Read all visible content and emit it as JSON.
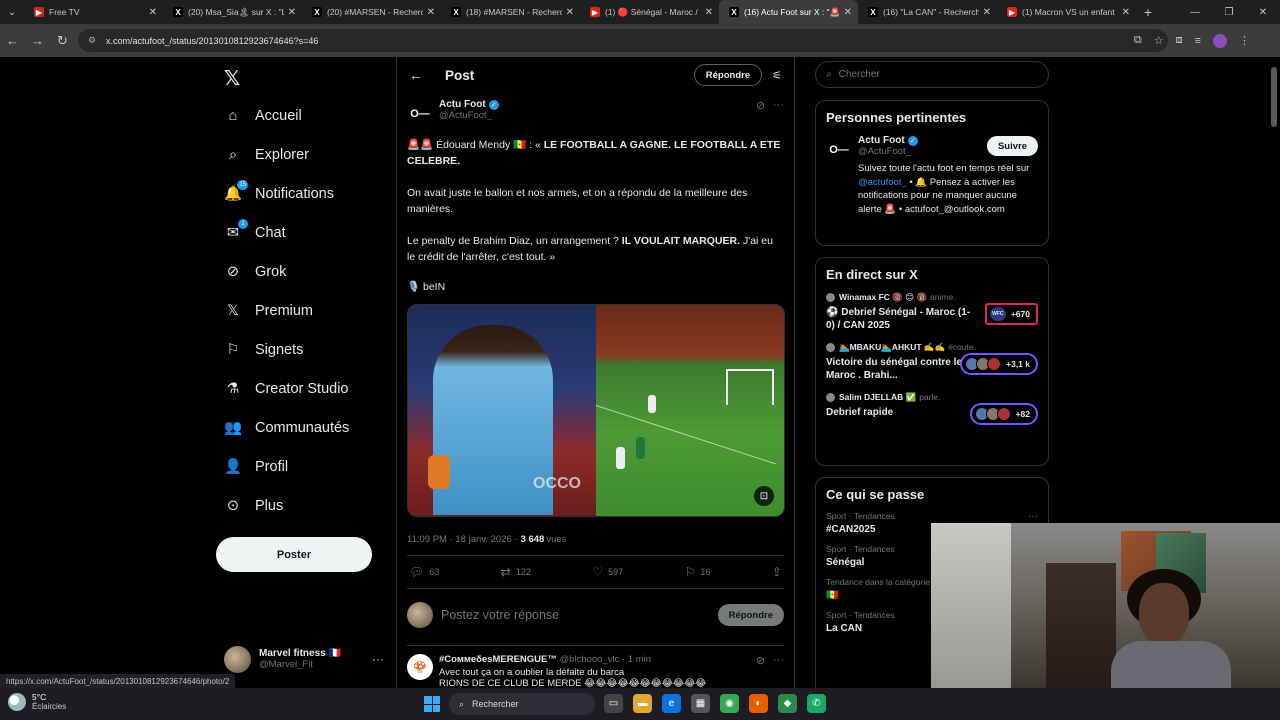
{
  "browser": {
    "tabs": [
      {
        "title": "Free TV",
        "fav_color": "#c62828",
        "fav": "▶",
        "active": false
      },
      {
        "title": "(20) Msa_Sia🏝 sur X : \"L'",
        "fav_color": "#000000",
        "fav": "X",
        "active": false
      },
      {
        "title": "(20) #MARSEN - Recherche",
        "fav_color": "#000000",
        "fav": "X",
        "active": false
      },
      {
        "title": "(18) #MARSEN - Recherche",
        "fav_color": "#000000",
        "fav": "X",
        "active": false
      },
      {
        "title": "(1) 🔴 Sénégal - Maroc /",
        "fav_color": "#e62117",
        "fav": "▶",
        "active": false
      },
      {
        "title": "(16) Actu Foot sur X : \"🚨",
        "fav_color": "#000000",
        "fav": "X",
        "active": true
      },
      {
        "title": "(16) \"La CAN\" - Recherche",
        "fav_color": "#000000",
        "fav": "X",
        "active": false
      },
      {
        "title": "(1) Macron VS un enfant",
        "fav_color": "#e62117",
        "fav": "▶",
        "active": false
      }
    ],
    "url": "x.com/actufoot_/status/2013010812923674646?s=46",
    "status_url": "https://x.com/ActuFoot_/status/2013010812923674646/photo/2"
  },
  "nav": {
    "items": [
      {
        "label": "Accueil",
        "icon": "home-icon",
        "glyph": "⌂",
        "badge": ""
      },
      {
        "label": "Explorer",
        "icon": "search-icon",
        "glyph": "⌕",
        "badge": ""
      },
      {
        "label": "Notifications",
        "icon": "bell-icon",
        "glyph": "🔔",
        "badge": "15"
      },
      {
        "label": "Chat",
        "icon": "mail-icon",
        "glyph": "✉",
        "badge": "1"
      },
      {
        "label": "Grok",
        "icon": "grok-icon",
        "glyph": "⊘",
        "badge": ""
      },
      {
        "label": "Premium",
        "icon": "x-premium-icon",
        "glyph": "𝕏",
        "badge": ""
      },
      {
        "label": "Signets",
        "icon": "bookmark-icon",
        "glyph": "⚐",
        "badge": ""
      },
      {
        "label": "Creator Studio",
        "icon": "flask-icon",
        "glyph": "⚗",
        "badge": ""
      },
      {
        "label": "Communautés",
        "icon": "people-icon",
        "glyph": "👥",
        "badge": ""
      },
      {
        "label": "Profil",
        "icon": "person-icon",
        "glyph": "👤",
        "badge": ""
      },
      {
        "label": "Plus",
        "icon": "more-circle-icon",
        "glyph": "⊙",
        "badge": ""
      }
    ],
    "post_label": "Poster",
    "account": {
      "name": "Marvel fitness 🇫🇷",
      "handle": "@Marvel_Fit"
    }
  },
  "main": {
    "title": "Post",
    "reply_label": "Répondre",
    "post": {
      "author": "Actu Foot",
      "handle": "@ActuFoot_",
      "para1_a": "🚨🚨 Édouard Mendy 🇸🇳 : « ",
      "para1_b": "LE FOOTBALL A GAGNE. LE FOOTBALL A ETE CELEBRE.",
      "para2": "On avait juste le ballon et nos armes, et on a répondu de la meilleure des manières.",
      "para3_a": "Le penalty de Brahim Diaz, un arrangement ? ",
      "para3_b": "IL VOULAIT MARQUER.",
      "para3_c": " J'ai eu le crédit de l'arrêter, c'est tout. »",
      "source": "🎙️ beIN",
      "time": "11:09 PM · 18 janv. 2026 · ",
      "views": "3 648",
      "views_label": "vues",
      "stats": {
        "replies": "63",
        "reposts": "122",
        "likes": "597",
        "bookmarks": "16"
      },
      "sponsor_text": "OCCO"
    },
    "compose_placeholder": "Postez votre réponse",
    "compose_reply": "Répondre",
    "reply": {
      "name": "#СоммеδеѕMERENGUE™",
      "handle": "@blchooo_vlc · 1 min",
      "text1": "Avec tout ça on a oublier la défaite du barca",
      "text2": "RIONS DE CE CLUB DE MERDE 😂😂😂😂😂😂😂😂😂😂😂"
    }
  },
  "right": {
    "search_placeholder": "Chercher",
    "relevant": {
      "title": "Personnes pertinentes",
      "name": "Actu Foot",
      "handle": "@ActuFoot_",
      "follow": "Suivre",
      "bio_a": "Suivez toute l'actu foot en temps réel sur ",
      "bio_link": "@actufoot_",
      "bio_b": " • 🔔 Pensez à activer les notifications pour ne manquer aucune alerte 🚨 • actufoot_@outlook.com"
    },
    "live": {
      "title": "En direct sur X",
      "items": [
        {
          "host": "Winamax FC 🔞 😊 🔞",
          "status": "anime.",
          "title": "⚽ Debrief Sénégal - Maroc (1-0) / CAN 2025",
          "count": "+670"
        },
        {
          "host": "🏊MBAKU🏊AHKUT ✍️✍️",
          "status": "écoute.",
          "title": "Victoire du sénégal contre le Maroc . Brahi...",
          "count": "+3,1 k"
        },
        {
          "host": "Salim DJELLAB ✅",
          "status": "parle.",
          "title": "Debrief rapide",
          "count": "+82"
        }
      ]
    },
    "trends": {
      "title": "Ce qui se passe",
      "items": [
        {
          "cat": "Sport · Tendances",
          "name": "#CAN2025"
        },
        {
          "cat": "Sport · Tendances",
          "name": "Sénégal"
        },
        {
          "cat": "Tendance dans la catégorie",
          "name": "🇸🇳"
        },
        {
          "cat": "Sport · Tendances",
          "name": "La CAN"
        }
      ]
    }
  },
  "taskbar": {
    "temp": "5°C",
    "weather": "Éclaircies",
    "search": "Rechercher"
  }
}
